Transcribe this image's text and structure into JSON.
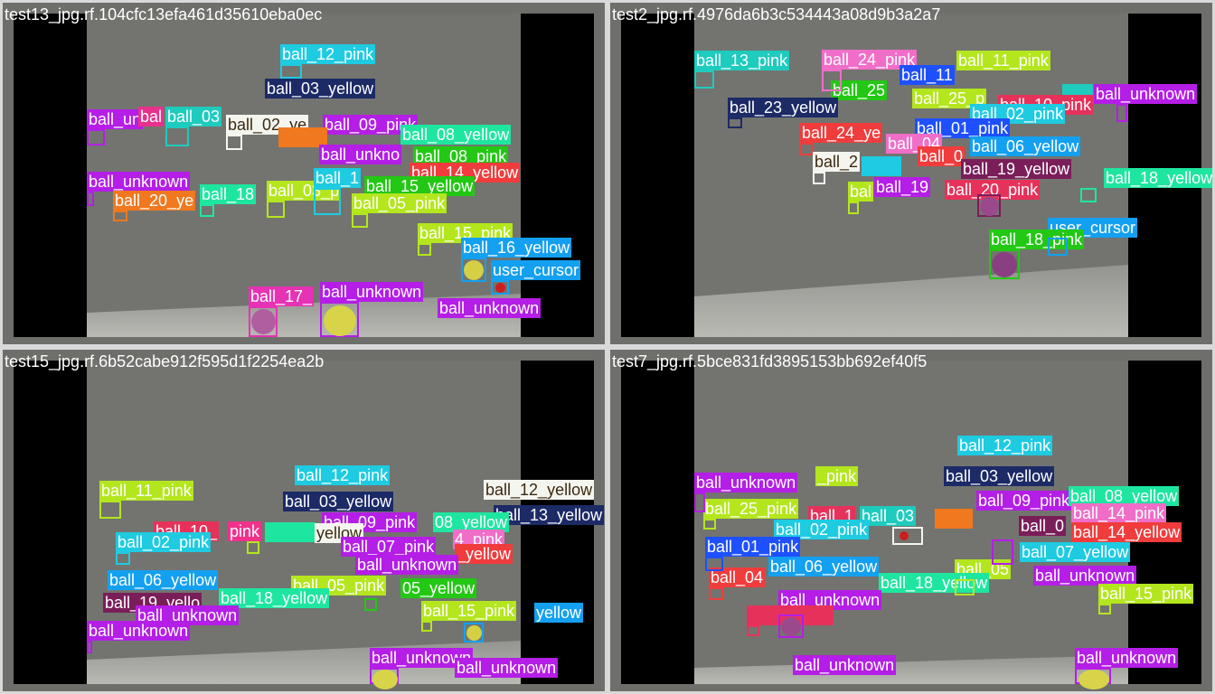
{
  "panels": [
    {
      "title": "test13_jpg.rf.104cfc13efa461d35610eba0ec"
    },
    {
      "title": "test2_jpg.rf.4976da6b3c534443a08d9b3a2a7"
    },
    {
      "title": "test15_jpg.rf.6b52cabe912f595d1f2254ea2b"
    },
    {
      "title": "test7_jpg.rf.5bce831fd3895153bb692ef40f5"
    }
  ],
  "labels": {
    "p1": [
      "ball_12_pink",
      "ball_03_yellow",
      "ball_un",
      "bal",
      "ball_03",
      "ball_02_ye",
      "ball_09_pink",
      "ball_08_yellow",
      "ball_unkno",
      "ball_08_pink",
      "ball_14_yellow",
      "ball_unknown",
      "ball_20_ye",
      "ball_18",
      "ball_03_p",
      "ball_1",
      "ball_15_yellow",
      "ball_05_pink",
      "ball_15_pink",
      "ball_16_yellow",
      "user_cursor",
      "ball_17_",
      "ball_unknown",
      "ball_unknown"
    ],
    "p2": [
      "ball_13_pink",
      "ball_24_pink",
      "ball_11",
      "ball_11_pink",
      "ball_25",
      "ball_25_p",
      "ball_unknown",
      "ball_10_pink",
      "ball_23_yellow",
      "ball_02_pink",
      "ball_24_ye",
      "ball_01_pink",
      "ball_04",
      "ball_06_yellow",
      "ball_2",
      "ball_0",
      "ball_19_yellow",
      "ball_18_yellow",
      "bal",
      "ball_19",
      "ball_20_pink",
      "user_cursor",
      "ball_18_pink"
    ],
    "p3": [
      "ball_11_pink",
      "ball_12_pink",
      "ball_12_yellow",
      "ball_03_yellow",
      "ball_13_yellow",
      "ball_10_",
      "pink",
      "ball_09_pink",
      "08_yellow",
      "ball_02_pink",
      "yellow",
      "ball_07_pink",
      "4_pink",
      "_yellow",
      "ball_unknown",
      "ball_06_yellow",
      "ball_05_pink",
      "05_yellow",
      "ball_19_yello",
      "ball_18_yellow",
      "ball_unknown",
      "ball_15_pink",
      "yellow",
      "ball_unknown",
      "ball_unknown",
      "ball_unknown"
    ],
    "p4": [
      "ball_12_pink",
      "ball_unknown",
      "_pink",
      "ball_03_yellow",
      "ball_25_pink",
      "ball_09_pink",
      "ball_08_yellow",
      "ball_1",
      "ball_03",
      "ball_02_pink",
      "ball_14_pink",
      "ball_0",
      "ball_14_yellow",
      "ball_01_pink",
      "ball_07_yellow",
      "ball_04",
      "ball_06_yellow",
      "ball_05",
      "ball_18_yellow",
      "ball_unknown",
      "ball_15_pink",
      "ball_unknown",
      "ball_unknown",
      "ball_unknown"
    ]
  },
  "colors": {
    "cyan": "#1ecbe1",
    "navy": "#1c2a66",
    "purple": "#b41ee6",
    "magenta": "#e6328c",
    "teal": "#1ee6b4",
    "green": "#23c814",
    "lime": "#b4e61e",
    "orange": "#f0781e",
    "red": "#f03c3c",
    "blue": "#1e50ff",
    "sky": "#14a0f0",
    "white": "#f5f5f0",
    "pink": "#f06ec8",
    "maroon": "#7a1e5a"
  },
  "ball_numbers": [
    "17",
    "17",
    "16",
    "18",
    "6",
    "6",
    "16"
  ]
}
